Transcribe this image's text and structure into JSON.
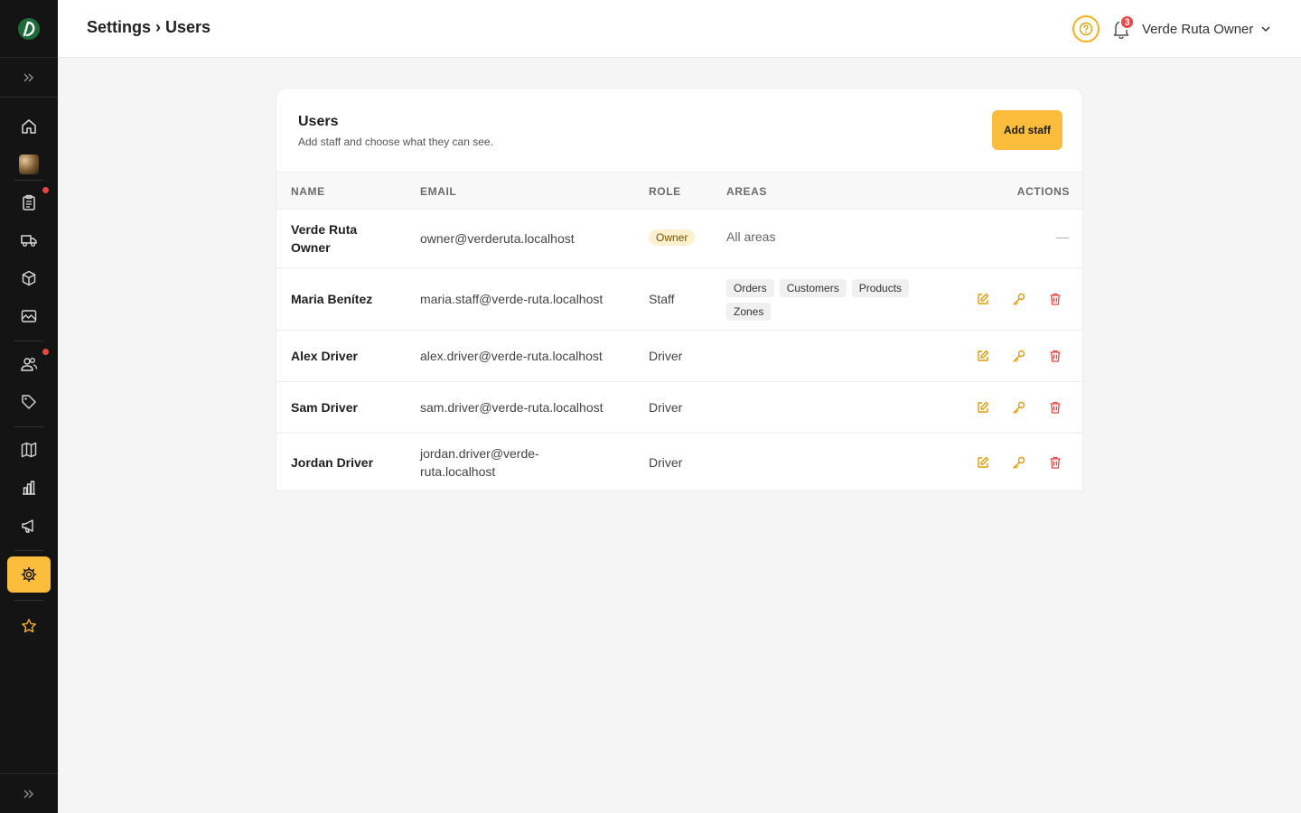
{
  "header": {
    "title": "Settings › Users",
    "notifications_count": "3",
    "user_name": "Verde Ruta Owner"
  },
  "sidebar": {
    "items": [
      {
        "icon": "home-icon",
        "dot": false
      },
      {
        "icon": "avatar-icon",
        "dot": false
      },
      {
        "icon": "clipboard-icon",
        "dot": true
      },
      {
        "icon": "truck-icon",
        "dot": false
      },
      {
        "icon": "box-icon",
        "dot": false
      },
      {
        "icon": "image-icon",
        "dot": false
      },
      {
        "icon": "users-icon",
        "dot": true
      },
      {
        "icon": "tag-icon",
        "dot": false
      },
      {
        "icon": "map-icon",
        "dot": false
      },
      {
        "icon": "bar-chart-icon",
        "dot": false
      },
      {
        "icon": "megaphone-icon",
        "dot": false
      },
      {
        "icon": "gear-icon",
        "dot": false,
        "active": true
      },
      {
        "icon": "star-icon",
        "dot": false
      }
    ]
  },
  "card": {
    "title": "Users",
    "subtitle": "Add staff and choose what they can see.",
    "add_button": "Add staff"
  },
  "table": {
    "columns": [
      "NAME",
      "EMAIL",
      "ROLE",
      "AREAS",
      "ACTIONS"
    ],
    "rows": [
      {
        "name": "Verde Ruta Owner",
        "email": "owner@verderuta.localhost",
        "role": "Owner",
        "areas_text": "All areas",
        "actions": "—"
      },
      {
        "name": "Maria Benítez",
        "email": "maria.staff@verde-ruta.localhost",
        "role": "Staff",
        "areas": [
          "Orders",
          "Customers",
          "Products",
          "Zones"
        ]
      },
      {
        "name": "Alex Driver",
        "email": "alex.driver@verde-ruta.localhost",
        "role": "Driver"
      },
      {
        "name": "Sam Driver",
        "email": "sam.driver@verde-ruta.localhost",
        "role": "Driver"
      },
      {
        "name": "Jordan Driver",
        "email": "jordan.driver@verde-ruta.localhost",
        "role": "Driver"
      }
    ]
  },
  "colors": {
    "accent": "#fbbd3b",
    "sidebar_bg": "#141414",
    "danger": "#ef4444"
  }
}
